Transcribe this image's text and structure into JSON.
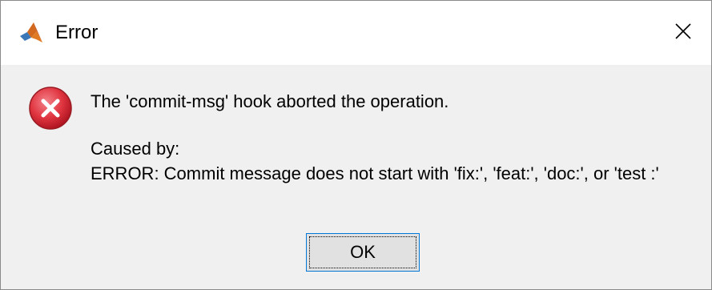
{
  "window": {
    "title": "Error",
    "app_icon": "matlab-logo-icon",
    "close_icon": "close-icon"
  },
  "dialog": {
    "icon": "error-icon",
    "message": "The 'commit-msg' hook aborted the operation.",
    "caused_by_label": "Caused by:",
    "error_detail": "ERROR: Commit message does not start with 'fix:', 'feat:', 'doc:', or 'test :'",
    "ok_label": "OK"
  },
  "colors": {
    "title_bg": "#ffffff",
    "body_bg": "#f0f0f0",
    "error_red": "#d9232e",
    "focus_border": "#0078d7"
  }
}
